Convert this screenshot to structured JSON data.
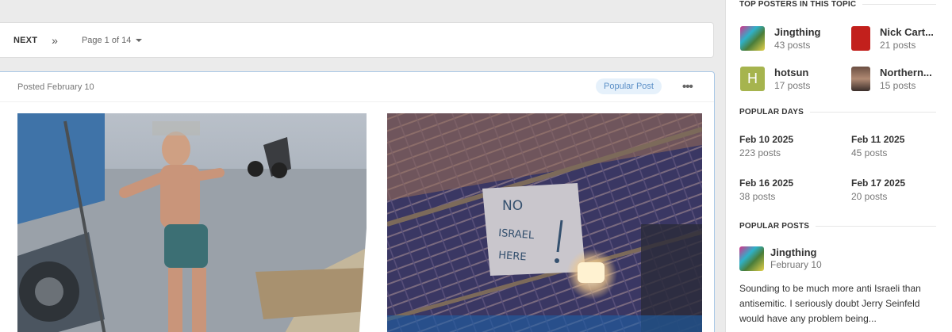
{
  "pager": {
    "next_label": "NEXT",
    "skip_icon": "double-chevron-right-icon",
    "page_label": "Page 1 of 14"
  },
  "post": {
    "posted": "Posted February 10",
    "badge": "Popular Post",
    "menu_icon": "more-options-icon",
    "image_left_desc": "street-photo",
    "sign_text": [
      "NO",
      "ISRAEL",
      "HERE"
    ]
  },
  "sidebar": {
    "top_posters_title": "TOP POSTERS IN THIS TOPIC",
    "top_posters": [
      {
        "name": "Jingthing",
        "posts": "43 posts",
        "avatar_color": "#4a7d3a"
      },
      {
        "name": "Nick Cart...",
        "posts": "21 posts",
        "avatar_color": "#c2201c"
      },
      {
        "name": "hotsun",
        "posts": "17 posts",
        "avatar_letter": "H",
        "avatar_color": "#a6b44e"
      },
      {
        "name": "Northern...",
        "posts": "15 posts",
        "avatar_color": "#8c6b5d"
      }
    ],
    "popular_days_title": "POPULAR DAYS",
    "popular_days": [
      {
        "date": "Feb 10 2025",
        "posts": "223 posts"
      },
      {
        "date": "Feb 11 2025",
        "posts": "45 posts"
      },
      {
        "date": "Feb 16 2025",
        "posts": "38 posts"
      },
      {
        "date": "Feb 17 2025",
        "posts": "20 posts"
      }
    ],
    "popular_posts_title": "POPULAR POSTS",
    "popular_post": {
      "author": "Jingthing",
      "date": "February 10",
      "excerpt": "Sounding to be much more anti Israeli than antisemitic. I seriously doubt Jerry Seinfeld would have any problem being..."
    }
  }
}
